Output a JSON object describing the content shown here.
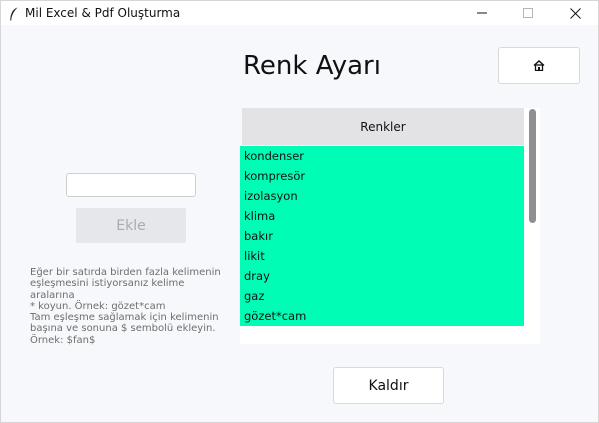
{
  "window": {
    "title": "Mil Excel & Pdf Oluşturma",
    "controls": {
      "minimize_icon": "minimize-icon",
      "maximize_icon": "maximize-icon",
      "close_icon": "close-icon"
    }
  },
  "page": {
    "heading": "Renk Ayarı",
    "home_icon": "home-icon"
  },
  "form": {
    "input_value": "",
    "add_label": "Ekle",
    "help_text": "Eğer bir satırda birden fazla kelimenin\neşleşmesini istiyorsanız kelime aralarına\n* koyun. Örnek: gözet*cam\n Tam eşleşme sağlamak için kelimenin\nbaşına ve sonuna $ sembolü ekleyin.\nÖrnek: $fan$"
  },
  "list": {
    "header": "Renkler",
    "highlight_color": "#00fdb5",
    "items": [
      "kondenser",
      "kompresör",
      "izolasyon",
      "klima",
      "bakır",
      "likit",
      "dray",
      "gaz",
      "gözet*cam"
    ]
  },
  "actions": {
    "remove_label": "Kaldır"
  }
}
